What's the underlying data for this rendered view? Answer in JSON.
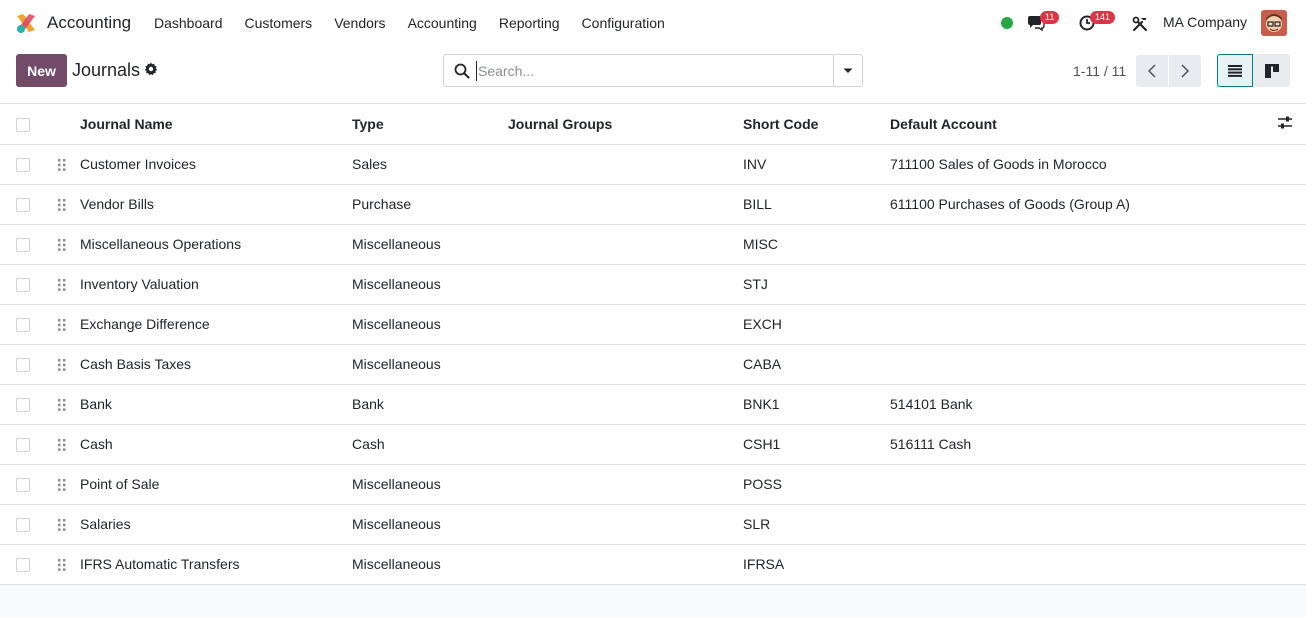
{
  "navbar": {
    "app_name": "Accounting",
    "menu": [
      "Dashboard",
      "Customers",
      "Vendors",
      "Accounting",
      "Reporting",
      "Configuration"
    ],
    "messages_count": "11",
    "activities_count": "141",
    "company": "MA Company"
  },
  "control_panel": {
    "new_label": "New",
    "title": "Journals",
    "search_placeholder": "Search...",
    "pager": "1-11 / 11"
  },
  "table": {
    "columns": [
      "Journal Name",
      "Type",
      "Journal Groups",
      "Short Code",
      "Default Account"
    ],
    "rows": [
      {
        "name": "Customer Invoices",
        "type": "Sales",
        "groups": "",
        "code": "INV",
        "account": "711100 Sales of Goods in Morocco"
      },
      {
        "name": "Vendor Bills",
        "type": "Purchase",
        "groups": "",
        "code": "BILL",
        "account": "611100 Purchases of Goods (Group A)"
      },
      {
        "name": "Miscellaneous Operations",
        "type": "Miscellaneous",
        "groups": "",
        "code": "MISC",
        "account": ""
      },
      {
        "name": "Inventory Valuation",
        "type": "Miscellaneous",
        "groups": "",
        "code": "STJ",
        "account": ""
      },
      {
        "name": "Exchange Difference",
        "type": "Miscellaneous",
        "groups": "",
        "code": "EXCH",
        "account": ""
      },
      {
        "name": "Cash Basis Taxes",
        "type": "Miscellaneous",
        "groups": "",
        "code": "CABA",
        "account": ""
      },
      {
        "name": "Bank",
        "type": "Bank",
        "groups": "",
        "code": "BNK1",
        "account": "514101 Bank"
      },
      {
        "name": "Cash",
        "type": "Cash",
        "groups": "",
        "code": "CSH1",
        "account": "516111 Cash"
      },
      {
        "name": "Point of Sale",
        "type": "Miscellaneous",
        "groups": "",
        "code": "POSS",
        "account": ""
      },
      {
        "name": "Salaries",
        "type": "Miscellaneous",
        "groups": "",
        "code": "SLR",
        "account": ""
      },
      {
        "name": "IFRS Automatic Transfers",
        "type": "Miscellaneous",
        "groups": "",
        "code": "IFRSA",
        "account": ""
      }
    ]
  },
  "colors": {
    "brand": "#714b67",
    "accent": "#017e84",
    "badge": "#dc3545",
    "online": "#28a745"
  },
  "icons": [
    "app-logo-icon",
    "chat-icon",
    "clock-icon",
    "tools-icon",
    "gear-icon",
    "search-icon",
    "caret-down-icon",
    "chevron-left-icon",
    "chevron-right-icon",
    "list-view-icon",
    "kanban-view-icon",
    "drag-handle-icon",
    "optional-columns-icon"
  ]
}
